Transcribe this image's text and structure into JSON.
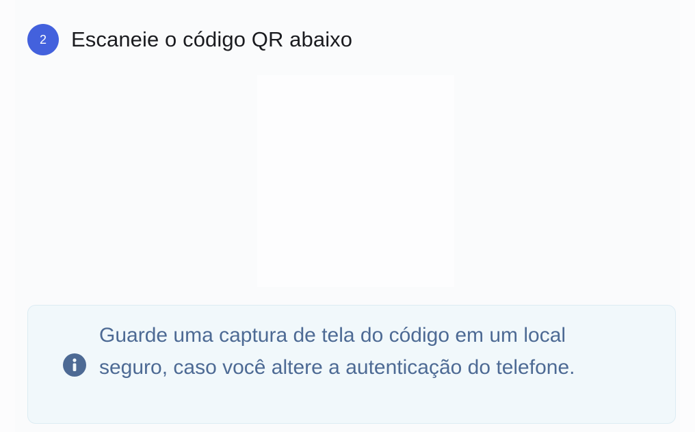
{
  "step": {
    "number": "2",
    "title": "Escaneie o código QR abaixo"
  },
  "info": {
    "icon": "info-icon",
    "message": "Guarde uma captura de tela do código em um local seguro, caso você altere a autenticação do telefone."
  },
  "colors": {
    "accent": "#4361dd",
    "info_text": "#4d6a94",
    "info_background": "#f1f8fb",
    "title_text": "#1a1b1f"
  }
}
